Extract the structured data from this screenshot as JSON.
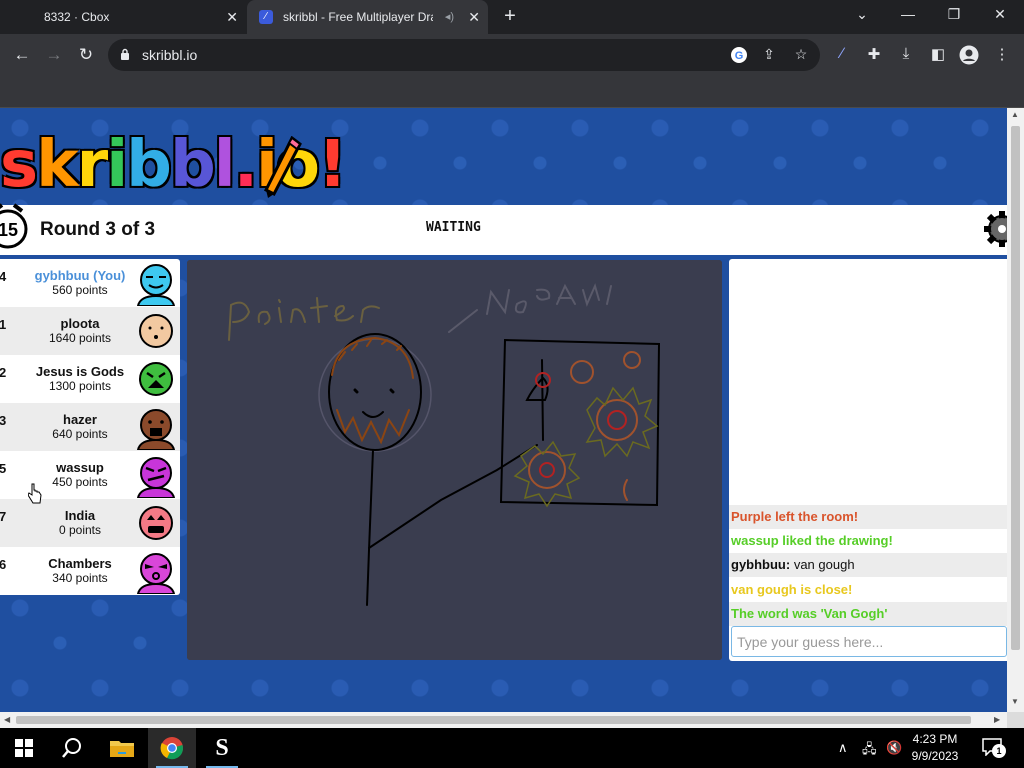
{
  "browser": {
    "tabs": [
      {
        "title": "8332 · Cbox"
      },
      {
        "title": "skribbl - Free Multiplayer Dra"
      }
    ],
    "url": "skribbl.io"
  },
  "game": {
    "logo": "skribbl.io",
    "timer": "15",
    "round_text": "Round 3 of 3",
    "status": "WAITING",
    "players": [
      {
        "rank": "4",
        "name": "gybhbuu (You)",
        "points": "560 points",
        "avatar_color": "#3ec9f0",
        "is_you": true
      },
      {
        "rank": "1",
        "name": "ploota",
        "points": "1640 points",
        "avatar_color": "#f2c9a1",
        "is_you": false
      },
      {
        "rank": "2",
        "name": "Jesus is Gods",
        "points": "1300 points",
        "avatar_color": "#3fbe3f",
        "is_you": false
      },
      {
        "rank": "3",
        "name": "hazer",
        "points": "640 points",
        "avatar_color": "#8b4a2b",
        "is_you": false
      },
      {
        "rank": "5",
        "name": "wassup",
        "points": "450 points",
        "avatar_color": "#c835d9",
        "is_you": false
      },
      {
        "rank": "7",
        "name": "India",
        "points": "0 points",
        "avatar_color": "#f47a86",
        "is_you": false
      },
      {
        "rank": "6",
        "name": "Chambers",
        "points": "340 points",
        "avatar_color": "#d946d9",
        "is_you": false
      }
    ],
    "canvas_bg": "#3a3d4f"
  },
  "chat": {
    "messages": [
      {
        "sender": "",
        "text": "Purple left the room!",
        "color": "#d9542c",
        "bold": true
      },
      {
        "sender": "",
        "text": "wassup liked the drawing!",
        "color": "#56ce27",
        "bold": true
      },
      {
        "sender": "gybhbuu:",
        "text": " van gough",
        "color": "#111111",
        "bold": false
      },
      {
        "sender": "",
        "text": "van gough is close!",
        "color": "#e8c81e",
        "bold": true
      },
      {
        "sender": "",
        "text": "The word was 'Van Gogh'",
        "color": "#56ce27",
        "bold": true
      }
    ],
    "input_placeholder": "Type your guess here..."
  },
  "taskbar": {
    "time": "4:23 PM",
    "date": "9/9/2023",
    "notification_count": "1"
  },
  "colors": {
    "browser_dark": "#202124",
    "toolbar": "#35363a",
    "page_blue": "#1f4fa0",
    "accent_blue": "#4a90d9"
  }
}
